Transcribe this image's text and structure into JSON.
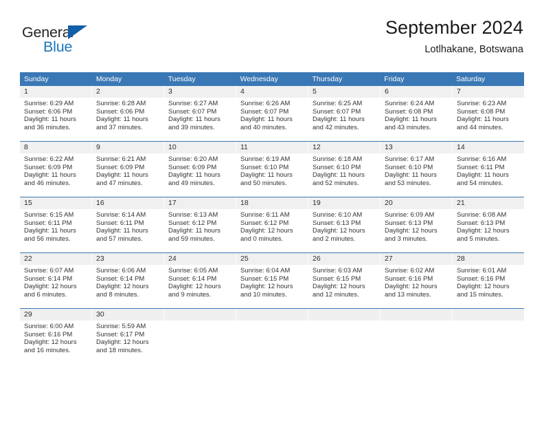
{
  "brand": {
    "name_part1": "General",
    "name_part2": "Blue",
    "triangle_icon": "triangle-icon",
    "color_dark": "#231f20",
    "color_blue": "#1b75bb"
  },
  "header": {
    "title": "September 2024",
    "subtitle": "Lotlhakane, Botswana"
  },
  "theme": {
    "header_bg": "#3a78b5",
    "header_text": "#ffffff",
    "daynum_bg": "#f0f0f0",
    "cell_bg": "#ffffff",
    "body_text": "#333333"
  },
  "calendar": {
    "weekdays": [
      "Sunday",
      "Monday",
      "Tuesday",
      "Wednesday",
      "Thursday",
      "Friday",
      "Saturday"
    ],
    "weeks": [
      [
        {
          "day": "1",
          "sunrise": "Sunrise: 6:29 AM",
          "sunset": "Sunset: 6:06 PM",
          "daylight1": "Daylight: 11 hours",
          "daylight2": "and 36 minutes."
        },
        {
          "day": "2",
          "sunrise": "Sunrise: 6:28 AM",
          "sunset": "Sunset: 6:06 PM",
          "daylight1": "Daylight: 11 hours",
          "daylight2": "and 37 minutes."
        },
        {
          "day": "3",
          "sunrise": "Sunrise: 6:27 AM",
          "sunset": "Sunset: 6:07 PM",
          "daylight1": "Daylight: 11 hours",
          "daylight2": "and 39 minutes."
        },
        {
          "day": "4",
          "sunrise": "Sunrise: 6:26 AM",
          "sunset": "Sunset: 6:07 PM",
          "daylight1": "Daylight: 11 hours",
          "daylight2": "and 40 minutes."
        },
        {
          "day": "5",
          "sunrise": "Sunrise: 6:25 AM",
          "sunset": "Sunset: 6:07 PM",
          "daylight1": "Daylight: 11 hours",
          "daylight2": "and 42 minutes."
        },
        {
          "day": "6",
          "sunrise": "Sunrise: 6:24 AM",
          "sunset": "Sunset: 6:08 PM",
          "daylight1": "Daylight: 11 hours",
          "daylight2": "and 43 minutes."
        },
        {
          "day": "7",
          "sunrise": "Sunrise: 6:23 AM",
          "sunset": "Sunset: 6:08 PM",
          "daylight1": "Daylight: 11 hours",
          "daylight2": "and 44 minutes."
        }
      ],
      [
        {
          "day": "8",
          "sunrise": "Sunrise: 6:22 AM",
          "sunset": "Sunset: 6:09 PM",
          "daylight1": "Daylight: 11 hours",
          "daylight2": "and 46 minutes."
        },
        {
          "day": "9",
          "sunrise": "Sunrise: 6:21 AM",
          "sunset": "Sunset: 6:09 PM",
          "daylight1": "Daylight: 11 hours",
          "daylight2": "and 47 minutes."
        },
        {
          "day": "10",
          "sunrise": "Sunrise: 6:20 AM",
          "sunset": "Sunset: 6:09 PM",
          "daylight1": "Daylight: 11 hours",
          "daylight2": "and 49 minutes."
        },
        {
          "day": "11",
          "sunrise": "Sunrise: 6:19 AM",
          "sunset": "Sunset: 6:10 PM",
          "daylight1": "Daylight: 11 hours",
          "daylight2": "and 50 minutes."
        },
        {
          "day": "12",
          "sunrise": "Sunrise: 6:18 AM",
          "sunset": "Sunset: 6:10 PM",
          "daylight1": "Daylight: 11 hours",
          "daylight2": "and 52 minutes."
        },
        {
          "day": "13",
          "sunrise": "Sunrise: 6:17 AM",
          "sunset": "Sunset: 6:10 PM",
          "daylight1": "Daylight: 11 hours",
          "daylight2": "and 53 minutes."
        },
        {
          "day": "14",
          "sunrise": "Sunrise: 6:16 AM",
          "sunset": "Sunset: 6:11 PM",
          "daylight1": "Daylight: 11 hours",
          "daylight2": "and 54 minutes."
        }
      ],
      [
        {
          "day": "15",
          "sunrise": "Sunrise: 6:15 AM",
          "sunset": "Sunset: 6:11 PM",
          "daylight1": "Daylight: 11 hours",
          "daylight2": "and 56 minutes."
        },
        {
          "day": "16",
          "sunrise": "Sunrise: 6:14 AM",
          "sunset": "Sunset: 6:11 PM",
          "daylight1": "Daylight: 11 hours",
          "daylight2": "and 57 minutes."
        },
        {
          "day": "17",
          "sunrise": "Sunrise: 6:13 AM",
          "sunset": "Sunset: 6:12 PM",
          "daylight1": "Daylight: 11 hours",
          "daylight2": "and 59 minutes."
        },
        {
          "day": "18",
          "sunrise": "Sunrise: 6:11 AM",
          "sunset": "Sunset: 6:12 PM",
          "daylight1": "Daylight: 12 hours",
          "daylight2": "and 0 minutes."
        },
        {
          "day": "19",
          "sunrise": "Sunrise: 6:10 AM",
          "sunset": "Sunset: 6:13 PM",
          "daylight1": "Daylight: 12 hours",
          "daylight2": "and 2 minutes."
        },
        {
          "day": "20",
          "sunrise": "Sunrise: 6:09 AM",
          "sunset": "Sunset: 6:13 PM",
          "daylight1": "Daylight: 12 hours",
          "daylight2": "and 3 minutes."
        },
        {
          "day": "21",
          "sunrise": "Sunrise: 6:08 AM",
          "sunset": "Sunset: 6:13 PM",
          "daylight1": "Daylight: 12 hours",
          "daylight2": "and 5 minutes."
        }
      ],
      [
        {
          "day": "22",
          "sunrise": "Sunrise: 6:07 AM",
          "sunset": "Sunset: 6:14 PM",
          "daylight1": "Daylight: 12 hours",
          "daylight2": "and 6 minutes."
        },
        {
          "day": "23",
          "sunrise": "Sunrise: 6:06 AM",
          "sunset": "Sunset: 6:14 PM",
          "daylight1": "Daylight: 12 hours",
          "daylight2": "and 8 minutes."
        },
        {
          "day": "24",
          "sunrise": "Sunrise: 6:05 AM",
          "sunset": "Sunset: 6:14 PM",
          "daylight1": "Daylight: 12 hours",
          "daylight2": "and 9 minutes."
        },
        {
          "day": "25",
          "sunrise": "Sunrise: 6:04 AM",
          "sunset": "Sunset: 6:15 PM",
          "daylight1": "Daylight: 12 hours",
          "daylight2": "and 10 minutes."
        },
        {
          "day": "26",
          "sunrise": "Sunrise: 6:03 AM",
          "sunset": "Sunset: 6:15 PM",
          "daylight1": "Daylight: 12 hours",
          "daylight2": "and 12 minutes."
        },
        {
          "day": "27",
          "sunrise": "Sunrise: 6:02 AM",
          "sunset": "Sunset: 6:16 PM",
          "daylight1": "Daylight: 12 hours",
          "daylight2": "and 13 minutes."
        },
        {
          "day": "28",
          "sunrise": "Sunrise: 6:01 AM",
          "sunset": "Sunset: 6:16 PM",
          "daylight1": "Daylight: 12 hours",
          "daylight2": "and 15 minutes."
        }
      ],
      [
        {
          "day": "29",
          "sunrise": "Sunrise: 6:00 AM",
          "sunset": "Sunset: 6:16 PM",
          "daylight1": "Daylight: 12 hours",
          "daylight2": "and 16 minutes."
        },
        {
          "day": "30",
          "sunrise": "Sunrise: 5:59 AM",
          "sunset": "Sunset: 6:17 PM",
          "daylight1": "Daylight: 12 hours",
          "daylight2": "and 18 minutes."
        },
        {
          "day": "",
          "sunrise": "",
          "sunset": "",
          "daylight1": "",
          "daylight2": ""
        },
        {
          "day": "",
          "sunrise": "",
          "sunset": "",
          "daylight1": "",
          "daylight2": ""
        },
        {
          "day": "",
          "sunrise": "",
          "sunset": "",
          "daylight1": "",
          "daylight2": ""
        },
        {
          "day": "",
          "sunrise": "",
          "sunset": "",
          "daylight1": "",
          "daylight2": ""
        },
        {
          "day": "",
          "sunrise": "",
          "sunset": "",
          "daylight1": "",
          "daylight2": ""
        }
      ]
    ]
  }
}
